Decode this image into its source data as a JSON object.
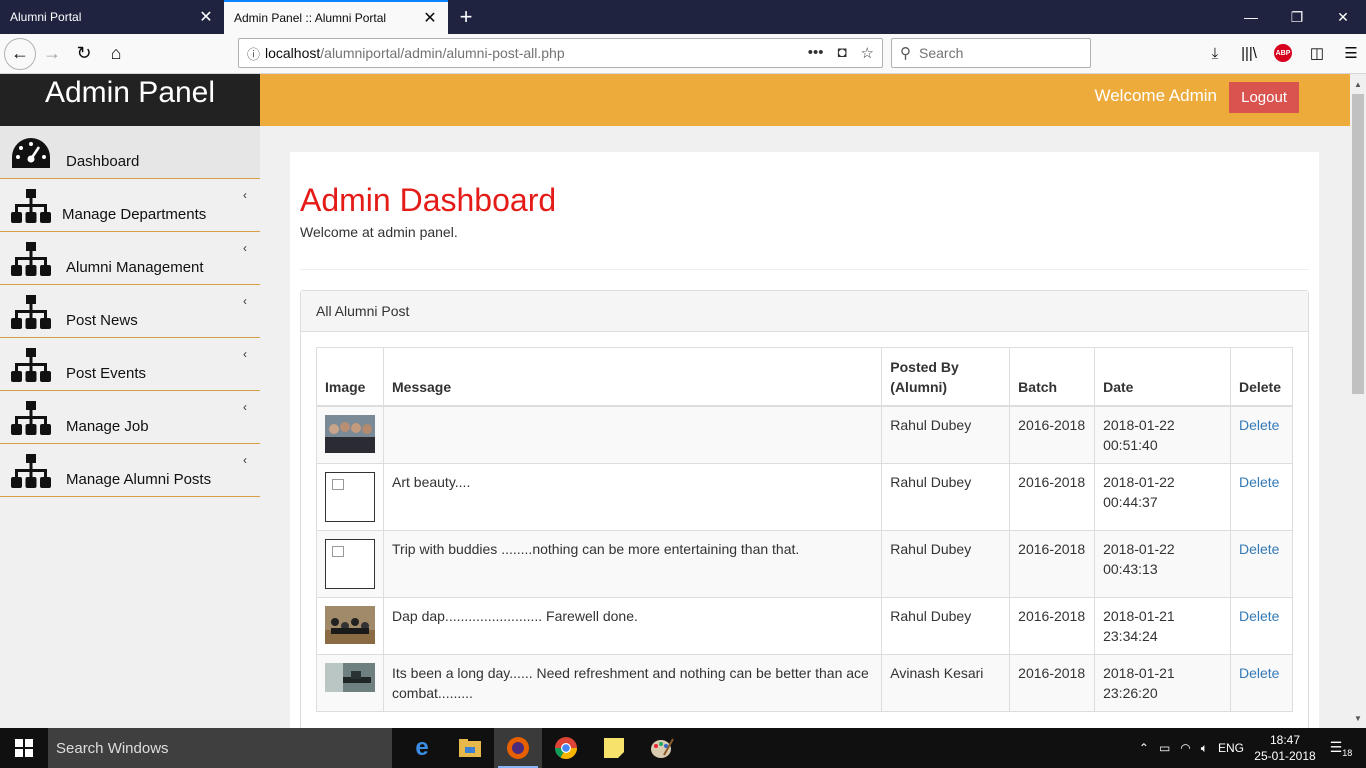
{
  "browser": {
    "tabs": [
      {
        "title": "Alumni Portal",
        "active": false
      },
      {
        "title": "Admin Panel :: Alumni Portal",
        "active": true
      }
    ],
    "url_host": "localhost",
    "url_path": "/alumniportal/admin/alumni-post-all.php",
    "search_placeholder": "Search",
    "abp_label": "ABP"
  },
  "header": {
    "brand": "Admin Panel",
    "welcome": "Welcome Admin",
    "logout_label": "Logout"
  },
  "sidebar": {
    "items": [
      {
        "label": "Dashboard",
        "icon": "dashboard-gauge-icon"
      },
      {
        "label": "Manage Departments",
        "icon": "sitemap-icon"
      },
      {
        "label": "Alumni Management",
        "icon": "sitemap-icon"
      },
      {
        "label": "Post News",
        "icon": "sitemap-icon"
      },
      {
        "label": "Post Events",
        "icon": "sitemap-icon"
      },
      {
        "label": "Manage Job",
        "icon": "sitemap-icon"
      },
      {
        "label": "Manage Alumni Posts",
        "icon": "sitemap-icon"
      }
    ]
  },
  "main": {
    "title": "Admin Dashboard",
    "subtitle": "Welcome at admin panel.",
    "panel_title": "All Alumni Post",
    "columns": [
      "Image",
      "Message",
      "Posted By (Alumni)",
      "Batch",
      "Date",
      "Delete"
    ],
    "rows": [
      {
        "image": "photo",
        "message": "",
        "posted_by": "Rahul Dubey",
        "batch": "2016-2018",
        "date_day": "2018-01-22",
        "date_time": "00:51:40",
        "delete": "Delete"
      },
      {
        "image": "broken",
        "message": "Art beauty....",
        "posted_by": "Rahul Dubey",
        "batch": "2016-2018",
        "date_day": "2018-01-22",
        "date_time": "00:44:37",
        "delete": "Delete"
      },
      {
        "image": "broken",
        "message": "Trip with buddies ........nothing can be more entertaining than that.",
        "posted_by": "Rahul Dubey",
        "batch": "2016-2018",
        "date_day": "2018-01-22",
        "date_time": "00:43:13",
        "delete": "Delete"
      },
      {
        "image": "photo",
        "message": "Dap dap......................... Farewell done.",
        "posted_by": "Rahul Dubey",
        "batch": "2016-2018",
        "date_day": "2018-01-21",
        "date_time": "23:34:24",
        "delete": "Delete"
      },
      {
        "image": "photo",
        "message": "Its been a long day...... Need refreshment and nothing can be better than ace combat.........",
        "posted_by": "Avinash Kesari",
        "batch": "2016-2018",
        "date_day": "2018-01-21",
        "date_time": "23:26:20",
        "delete": "Delete"
      }
    ]
  },
  "taskbar": {
    "search_placeholder": "Search Windows",
    "language": "ENG",
    "time": "18:47",
    "date": "25-01-2018",
    "notifications": "18"
  },
  "colors": {
    "header": "#edab3c",
    "brand_bg": "#222222",
    "title_red": "#e41b17",
    "logout": "#d9534f",
    "link": "#337ab7"
  }
}
